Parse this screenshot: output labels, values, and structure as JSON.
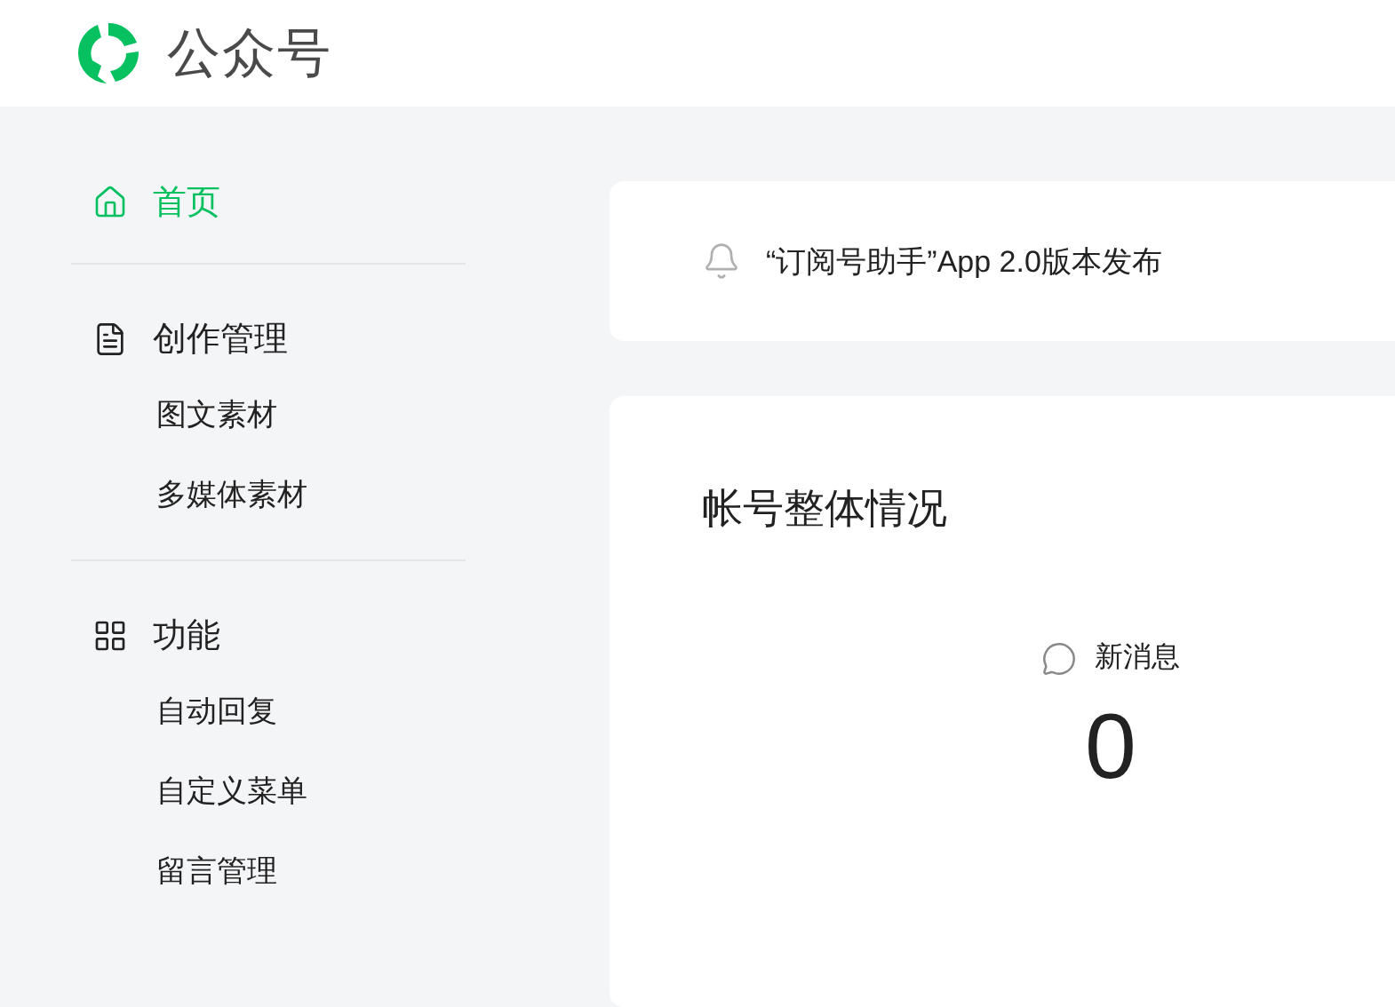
{
  "header": {
    "title": "公众号"
  },
  "sidebar": {
    "sections": [
      {
        "label": "首页",
        "selected": true
      },
      {
        "label": "创作管理",
        "selected": false,
        "children": [
          {
            "label": "图文素材",
            "selected": false
          },
          {
            "label": "多媒体素材",
            "selected": false
          }
        ]
      },
      {
        "label": "功能",
        "selected": false,
        "children": [
          {
            "label": "自动回复",
            "selected": false
          },
          {
            "label": "自定义菜单",
            "selected": false
          },
          {
            "label": "留言管理",
            "selected": false
          }
        ]
      }
    ]
  },
  "notice": {
    "text": "“订阅号助手”App 2.0版本发布"
  },
  "overview": {
    "title": "帐号整体情况",
    "stats": [
      {
        "label": "新消息",
        "value": "0"
      }
    ]
  }
}
